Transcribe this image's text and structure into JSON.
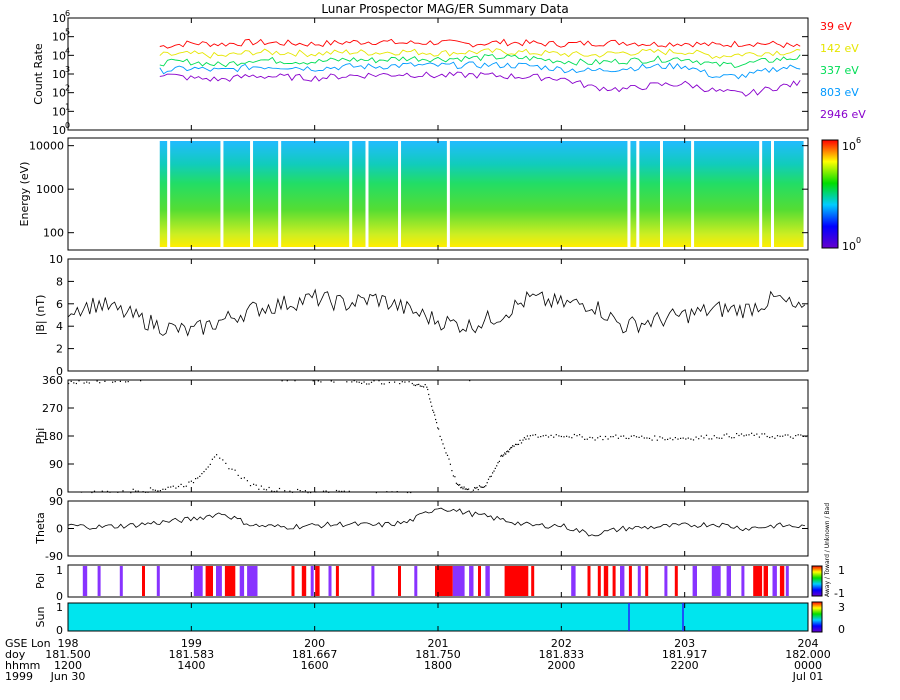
{
  "title": "Lunar Prospector MAG/ER Summary Data",
  "panels": {
    "count_rate": {
      "ylabel": "Count Rate",
      "yticks": [
        {
          "e": "6",
          "exp": 6
        },
        {
          "e": "5",
          "exp": 5
        },
        {
          "e": "4",
          "exp": 4
        },
        {
          "e": "3",
          "exp": 3
        },
        {
          "e": "2",
          "exp": 2
        },
        {
          "e": "1",
          "exp": 1
        },
        {
          "e": "0",
          "exp": 0
        }
      ],
      "tick_base": "10",
      "legend": [
        {
          "label": "39 eV",
          "color": "#ff0000"
        },
        {
          "label": "142 eV",
          "color": "#e6e600"
        },
        {
          "label": "337 eV",
          "color": "#00dd55"
        },
        {
          "label": "803 eV",
          "color": "#0099ff"
        },
        {
          "label": "2946 eV",
          "color": "#8800cc"
        }
      ]
    },
    "energy": {
      "ylabel": "Energy (eV)",
      "yticks": [
        "10000",
        "1000",
        "100"
      ],
      "colorbar_top_base": "10",
      "colorbar_top_exp": "6",
      "colorbar_bottom_base": "10",
      "colorbar_bottom_exp": "0"
    },
    "bmag": {
      "ylabel": "|B| (nT)",
      "yticks": [
        "10",
        "8",
        "6",
        "4",
        "2",
        "0"
      ]
    },
    "phi": {
      "ylabel": "Phi",
      "yticks": [
        "360",
        "270",
        "180",
        "90",
        "0"
      ]
    },
    "theta": {
      "ylabel": "Theta",
      "yticks": [
        "90",
        "0",
        "-90"
      ]
    },
    "pol": {
      "ylabel": "Pol",
      "yticks": [
        "1",
        "0"
      ],
      "colorbar_top": "1",
      "colorbar_bottom": "-1",
      "side_text": "Away / Toward / Unknown / Bad"
    },
    "sun": {
      "ylabel": "Sun",
      "yticks": [
        "1",
        "0"
      ],
      "colorbar_top": "3",
      "colorbar_bottom": "0"
    }
  },
  "xaxis": {
    "row_labels": [
      "GSE Lon",
      "doy",
      "hhmm",
      "1999"
    ],
    "ticks": [
      {
        "lon": "198",
        "doy": "181.500",
        "hhmm": "1200",
        "date": "Jun 30"
      },
      {
        "lon": "199",
        "doy": "181.583",
        "hhmm": "1400",
        "date": ""
      },
      {
        "lon": "200",
        "doy": "181.667",
        "hhmm": "1600",
        "date": ""
      },
      {
        "lon": "201",
        "doy": "181.750",
        "hhmm": "1800",
        "date": ""
      },
      {
        "lon": "202",
        "doy": "181.833",
        "hhmm": "2000",
        "date": ""
      },
      {
        "lon": "203",
        "doy": "181.917",
        "hhmm": "2200",
        "date": ""
      },
      {
        "lon": "204",
        "doy": "182.000",
        "hhmm": "0000",
        "date": "Jul 01"
      }
    ]
  },
  "chart_data": [
    {
      "type": "line",
      "title": "Lunar Prospector MAG/ER Summary Data",
      "ylabel": "Count Rate",
      "yscale": "log",
      "ylim": [
        1,
        1000000
      ],
      "x": [
        181.562,
        181.583,
        181.604,
        181.625,
        181.646,
        181.667,
        181.688,
        181.708,
        181.729,
        181.75,
        181.771,
        181.792,
        181.812,
        181.833,
        181.854,
        181.875,
        181.896,
        181.917,
        181.938,
        181.958,
        181.979,
        181.997
      ],
      "series": [
        {
          "name": "39 eV",
          "values": [
            30000,
            45000,
            40000,
            50000,
            45000,
            40000,
            50000,
            55000,
            45000,
            50000,
            40000,
            50000,
            45000,
            40000,
            45000,
            50000,
            40000,
            45000,
            35000,
            45000,
            40000,
            25000
          ]
        },
        {
          "name": "142 eV",
          "values": [
            10000,
            12000,
            9000,
            15000,
            14000,
            12000,
            15000,
            14000,
            16000,
            13000,
            15000,
            16000,
            14000,
            12000,
            10000,
            14000,
            15000,
            16000,
            9000,
            12000,
            15000,
            14000
          ]
        },
        {
          "name": "337 eV",
          "values": [
            4000,
            4500,
            3000,
            6000,
            5000,
            4500,
            6000,
            5500,
            7000,
            6500,
            7000,
            8000,
            7000,
            5000,
            4000,
            5000,
            6000,
            7000,
            3000,
            3500,
            6000,
            8000
          ]
        },
        {
          "name": "803 eV",
          "values": [
            1500,
            2000,
            1500,
            2500,
            2500,
            2000,
            2500,
            2500,
            3000,
            2800,
            3000,
            3000,
            2800,
            1800,
            1500,
            2000,
            2500,
            2800,
            700,
            800,
            2000,
            2500
          ]
        },
        {
          "name": "2946 eV",
          "values": [
            1000,
            600,
            500,
            800,
            700,
            600,
            800,
            900,
            1000,
            800,
            900,
            800,
            700,
            600,
            200,
            150,
            250,
            300,
            120,
            80,
            200,
            350
          ]
        }
      ]
    },
    {
      "type": "heatmap",
      "ylabel": "Energy (eV)",
      "yscale": "log",
      "ylim": [
        40,
        15000
      ],
      "color_range": [
        1,
        1000000
      ]
    },
    {
      "type": "line",
      "ylabel": "|B| (nT)",
      "ylim": [
        0,
        10
      ],
      "x": [
        181.5,
        181.521,
        181.542,
        181.562,
        181.583,
        181.604,
        181.625,
        181.646,
        181.667,
        181.688,
        181.708,
        181.729,
        181.75,
        181.771,
        181.792,
        181.812,
        181.833,
        181.854,
        181.875,
        181.896,
        181.917,
        181.938,
        181.958,
        181.979,
        182.0
      ],
      "values": [
        5.5,
        6.0,
        5.0,
        4.0,
        3.5,
        4.5,
        5.5,
        6.0,
        6.5,
        6.0,
        6.5,
        5.5,
        4.5,
        4.0,
        5.0,
        6.5,
        6.0,
        6.0,
        4.0,
        4.5,
        5.0,
        5.5,
        5.5,
        6.5,
        5.0
      ]
    },
    {
      "type": "scatter",
      "ylabel": "Phi",
      "ylim": [
        0,
        360
      ],
      "x": [
        181.5,
        181.521,
        181.542,
        181.562,
        181.583,
        181.6,
        181.625,
        181.646,
        181.667,
        181.688,
        181.708,
        181.729,
        181.742,
        181.75,
        181.762,
        181.771,
        181.781,
        181.792,
        181.8,
        181.812,
        181.833,
        181.854,
        181.875,
        181.896,
        181.917,
        181.938,
        181.958,
        181.979,
        182.0
      ],
      "values": [
        355,
        360,
        5,
        10,
        30,
        115,
        20,
        5,
        2,
        358,
        355,
        358,
        340,
        200,
        30,
        5,
        20,
        110,
        150,
        180,
        185,
        175,
        180,
        175,
        175,
        180,
        185,
        180,
        180
      ]
    },
    {
      "type": "line",
      "ylabel": "Theta",
      "ylim": [
        -90,
        90
      ],
      "x": [
        181.5,
        181.521,
        181.542,
        181.562,
        181.583,
        181.604,
        181.625,
        181.646,
        181.667,
        181.688,
        181.708,
        181.729,
        181.75,
        181.771,
        181.792,
        181.812,
        181.833,
        181.854,
        181.875,
        181.896,
        181.917,
        181.938,
        181.958,
        181.979,
        182.0
      ],
      "values": [
        10,
        5,
        10,
        20,
        30,
        50,
        10,
        5,
        10,
        15,
        10,
        20,
        70,
        50,
        30,
        10,
        10,
        -20,
        0,
        5,
        10,
        15,
        0,
        10,
        5
      ]
    }
  ],
  "colors": {
    "spectrogram_low": "#ffff00",
    "spectrogram_mid": "#22cc22",
    "spectrogram_high": "#00bbff",
    "pol_away": "#ff0000",
    "pol_toward": "#8833ff",
    "sun_fill": "#00e5ee",
    "sun_marks": "#2222ff"
  }
}
